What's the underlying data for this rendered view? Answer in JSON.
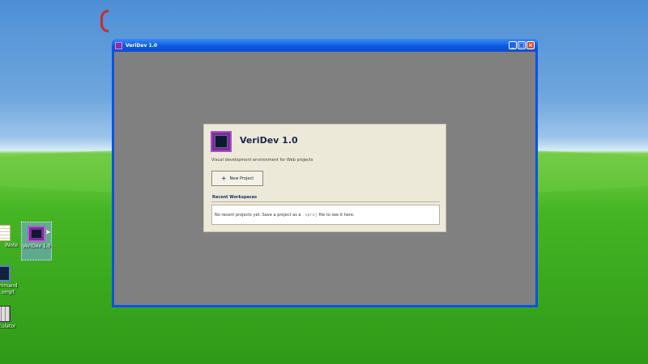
{
  "desktop": {
    "icons": {
      "notes": {
        "label": "lNote"
      },
      "command": {
        "label": "mmand\nompt"
      },
      "calculator": {
        "label": "culator"
      },
      "veridev": {
        "label": "VeriDev 1.0"
      }
    }
  },
  "window": {
    "title": "VeriDev 1.0",
    "controls": {
      "minimize": "_",
      "maximize": "□",
      "close": "×"
    }
  },
  "start_panel": {
    "app_name": "VeriDev 1.0",
    "subtitle": "Visual development environment for Web projects",
    "new_project": {
      "icon": "+",
      "label": "New Project"
    },
    "recent_heading": "Recent Workspaces",
    "recent_empty": {
      "before": "No recent projects yet. Save a project as a",
      "ext": ".vproj",
      "after": "file to see it here."
    }
  },
  "colors": {
    "titlebar": "#0a54e1",
    "client": "#808080",
    "panel": "#ece9d8",
    "accent_purple": "#7b2d99",
    "heading_blue": "#1b2e6b",
    "close_button": "#d9482d"
  }
}
